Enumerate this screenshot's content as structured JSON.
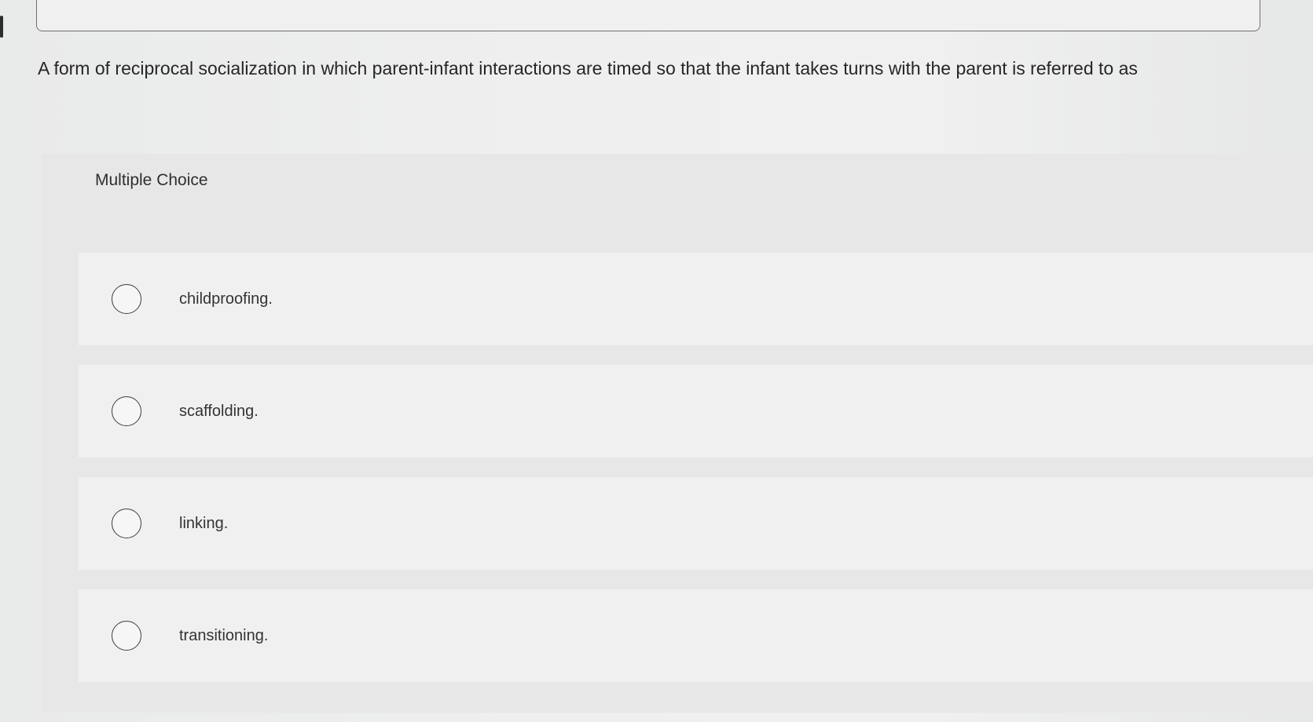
{
  "question": {
    "text": "A form of reciprocal socialization in which parent-infant interactions are timed so that the infant takes turns with the parent is referred to as"
  },
  "multiple_choice": {
    "title": "Multiple Choice",
    "options": [
      {
        "label": "childproofing."
      },
      {
        "label": "scaffolding."
      },
      {
        "label": "linking."
      },
      {
        "label": "transitioning."
      }
    ]
  },
  "colors": {
    "background": "#efefef",
    "panel": "#e7e7e7",
    "option_row": "#f0f0f0",
    "text": "#262626"
  }
}
